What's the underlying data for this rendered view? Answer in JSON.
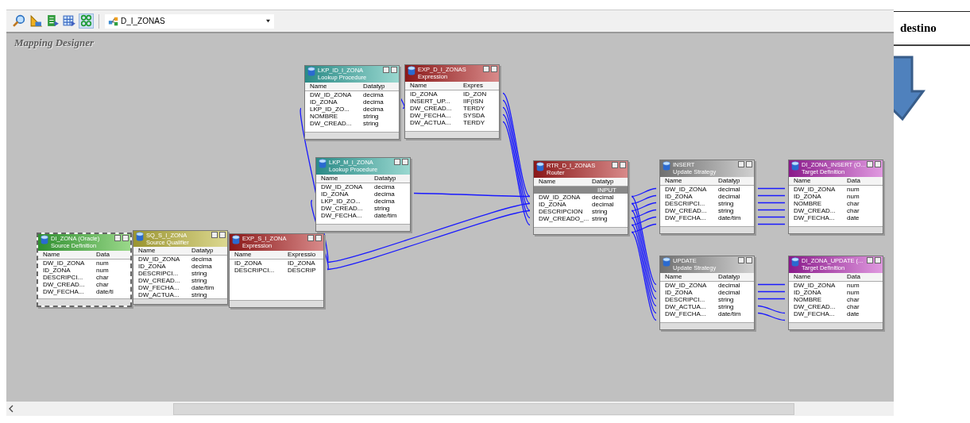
{
  "toolbar": {
    "mapping": "D_I_ZONAS"
  },
  "canvas_label": "Mapping Designer",
  "nodes": [
    {
      "kind": "source",
      "title": "DI_ZONA (Oracle)",
      "subtitle": "Source Definition",
      "columns": [
        "Name",
        "Data"
      ],
      "rows": [
        [
          "DW_ID_ZONA",
          "num"
        ],
        [
          "ID_ZONA",
          "num"
        ],
        [
          "DESCRIPCI...",
          "char"
        ],
        [
          "DW_CREAD...",
          "char"
        ],
        [
          "DW_FECHA...",
          "date/ti"
        ]
      ]
    },
    {
      "kind": "qualifier",
      "title": "SQ_S_I_ZONA",
      "subtitle": "Source Qualifier",
      "columns": [
        "Name",
        "Datatyp"
      ],
      "rows": [
        [
          "DW_ID_ZONA",
          "decima"
        ],
        [
          "ID_ZONA",
          "decima"
        ],
        [
          "DESCRIPCI...",
          "string"
        ],
        [
          "DW_CREAD...",
          "string"
        ],
        [
          "DW_FECHA...",
          "date/tim"
        ],
        [
          "DW_ACTUA...",
          "string"
        ]
      ]
    },
    {
      "kind": "expression",
      "title": "EXP_S_I_ZONA",
      "subtitle": "Expression",
      "columns": [
        "Name",
        "Expressio"
      ],
      "rows": [
        [
          "ID_ZONA",
          "ID_ZONA"
        ],
        [
          "DESCRIPCI...",
          "DESCRIP"
        ]
      ]
    },
    {
      "kind": "lookup",
      "title": "LKP_ID_I_ZONA",
      "subtitle": "Lookup Procedure",
      "columns": [
        "Name",
        "Datatyp"
      ],
      "rows": [
        [
          "DW_ID_ZONA",
          "decima"
        ],
        [
          "ID_ZONA",
          "decima"
        ],
        [
          "LKP_ID_ZO...",
          "decima"
        ],
        [
          "NOMBRE",
          "string"
        ],
        [
          "DW_CREAD...",
          "string"
        ]
      ]
    },
    {
      "kind": "expression",
      "title": "EXP_D_I_ZONAS",
      "subtitle": "Expression",
      "columns": [
        "Name",
        "Expres"
      ],
      "rows": [
        [
          "ID_ZONA",
          "ID_ZON"
        ],
        [
          "INSERT_UP...",
          "IIF(ISN"
        ],
        [
          "DW_CREAD...",
          "TERDY"
        ],
        [
          "DW_FECHA...",
          "SYSDA"
        ],
        [
          "DW_ACTUA...",
          "TERDY"
        ]
      ]
    },
    {
      "kind": "lookup",
      "title": "LKP_M_I_ZONA",
      "subtitle": "Lookup Procedure",
      "columns": [
        "Name",
        "Datatyp"
      ],
      "rows": [
        [
          "DW_ID_ZONA",
          "decima"
        ],
        [
          "ID_ZONA",
          "decima"
        ],
        [
          "LKP_ID_ZO...",
          "decima"
        ],
        [
          "DW_CREAD...",
          "string"
        ],
        [
          "DW_FECHA...",
          "date/tim"
        ]
      ]
    },
    {
      "kind": "router",
      "title": "RTR_D_I_ZONAS",
      "subtitle": "Router",
      "columns": [
        "Name",
        "Datatyp"
      ],
      "group": "INPUT",
      "rows": [
        [
          "DW_ID_ZONA",
          "decimal"
        ],
        [
          "ID_ZONA",
          "decimal"
        ],
        [
          "DESCRIPCION",
          "string"
        ],
        [
          "DW_CREADO_...",
          "string"
        ]
      ]
    },
    {
      "kind": "update",
      "title": "INSERT",
      "subtitle": "Update Strategy",
      "columns": [
        "Name",
        "Datatyp"
      ],
      "rows": [
        [
          "DW_ID_ZONA",
          "decimal"
        ],
        [
          "ID_ZONA",
          "decimal"
        ],
        [
          "DESCRIPCI...",
          "string"
        ],
        [
          "DW_CREAD...",
          "string"
        ],
        [
          "DW_FECHA...",
          "date/tim"
        ]
      ]
    },
    {
      "kind": "target",
      "title": "DI_ZONA_INSERT (O...",
      "subtitle": "Target Definition",
      "columns": [
        "Name",
        "Data"
      ],
      "rows": [
        [
          "DW_ID_ZONA",
          "num"
        ],
        [
          "ID_ZONA",
          "num"
        ],
        [
          "NOMBRE",
          "char"
        ],
        [
          "DW_CREAD...",
          "char"
        ],
        [
          "DW_FECHA...",
          "date"
        ]
      ]
    },
    {
      "kind": "update",
      "title": "UPDATE",
      "subtitle": "Update Strategy",
      "columns": [
        "Name",
        "Datatyp"
      ],
      "rows": [
        [
          "DW_ID_ZONA",
          "decimal"
        ],
        [
          "ID_ZONA",
          "decimal"
        ],
        [
          "DESCRIPCI...",
          "string"
        ],
        [
          "DW_ACTUA...",
          "string"
        ],
        [
          "DW_FECHA...",
          "date/tim"
        ]
      ]
    },
    {
      "kind": "target",
      "title": "DI_ZONA_UPDATE (...",
      "subtitle": "Target Definition",
      "columns": [
        "Name",
        "Data"
      ],
      "rows": [
        [
          "DW_ID_ZONA",
          "num"
        ],
        [
          "ID_ZONA",
          "num"
        ],
        [
          "NOMBRE",
          "char"
        ],
        [
          "DW_CREAD...",
          "char"
        ],
        [
          "DW_FECHA...",
          "date"
        ]
      ]
    }
  ],
  "document": {
    "heading": "destino"
  }
}
